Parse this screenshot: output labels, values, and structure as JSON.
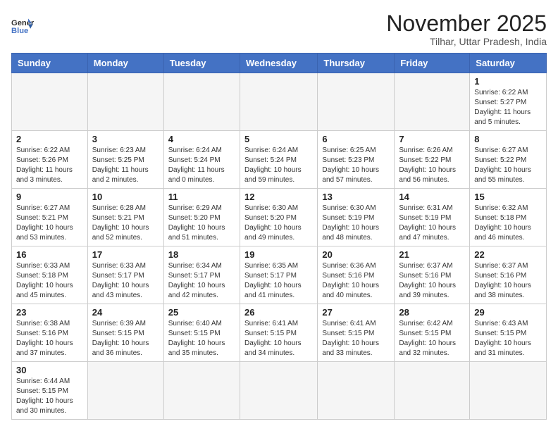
{
  "logo": {
    "text_general": "General",
    "text_blue": "Blue"
  },
  "title": "November 2025",
  "subtitle": "Tilhar, Uttar Pradesh, India",
  "days_of_week": [
    "Sunday",
    "Monday",
    "Tuesday",
    "Wednesday",
    "Thursday",
    "Friday",
    "Saturday"
  ],
  "weeks": [
    [
      {
        "day": "",
        "info": ""
      },
      {
        "day": "",
        "info": ""
      },
      {
        "day": "",
        "info": ""
      },
      {
        "day": "",
        "info": ""
      },
      {
        "day": "",
        "info": ""
      },
      {
        "day": "",
        "info": ""
      },
      {
        "day": "1",
        "info": "Sunrise: 6:22 AM\nSunset: 5:27 PM\nDaylight: 11 hours and 5 minutes."
      }
    ],
    [
      {
        "day": "2",
        "info": "Sunrise: 6:22 AM\nSunset: 5:26 PM\nDaylight: 11 hours and 3 minutes."
      },
      {
        "day": "3",
        "info": "Sunrise: 6:23 AM\nSunset: 5:25 PM\nDaylight: 11 hours and 2 minutes."
      },
      {
        "day": "4",
        "info": "Sunrise: 6:24 AM\nSunset: 5:24 PM\nDaylight: 11 hours and 0 minutes."
      },
      {
        "day": "5",
        "info": "Sunrise: 6:24 AM\nSunset: 5:24 PM\nDaylight: 10 hours and 59 minutes."
      },
      {
        "day": "6",
        "info": "Sunrise: 6:25 AM\nSunset: 5:23 PM\nDaylight: 10 hours and 57 minutes."
      },
      {
        "day": "7",
        "info": "Sunrise: 6:26 AM\nSunset: 5:22 PM\nDaylight: 10 hours and 56 minutes."
      },
      {
        "day": "8",
        "info": "Sunrise: 6:27 AM\nSunset: 5:22 PM\nDaylight: 10 hours and 55 minutes."
      }
    ],
    [
      {
        "day": "9",
        "info": "Sunrise: 6:27 AM\nSunset: 5:21 PM\nDaylight: 10 hours and 53 minutes."
      },
      {
        "day": "10",
        "info": "Sunrise: 6:28 AM\nSunset: 5:21 PM\nDaylight: 10 hours and 52 minutes."
      },
      {
        "day": "11",
        "info": "Sunrise: 6:29 AM\nSunset: 5:20 PM\nDaylight: 10 hours and 51 minutes."
      },
      {
        "day": "12",
        "info": "Sunrise: 6:30 AM\nSunset: 5:20 PM\nDaylight: 10 hours and 49 minutes."
      },
      {
        "day": "13",
        "info": "Sunrise: 6:30 AM\nSunset: 5:19 PM\nDaylight: 10 hours and 48 minutes."
      },
      {
        "day": "14",
        "info": "Sunrise: 6:31 AM\nSunset: 5:19 PM\nDaylight: 10 hours and 47 minutes."
      },
      {
        "day": "15",
        "info": "Sunrise: 6:32 AM\nSunset: 5:18 PM\nDaylight: 10 hours and 46 minutes."
      }
    ],
    [
      {
        "day": "16",
        "info": "Sunrise: 6:33 AM\nSunset: 5:18 PM\nDaylight: 10 hours and 45 minutes."
      },
      {
        "day": "17",
        "info": "Sunrise: 6:33 AM\nSunset: 5:17 PM\nDaylight: 10 hours and 43 minutes."
      },
      {
        "day": "18",
        "info": "Sunrise: 6:34 AM\nSunset: 5:17 PM\nDaylight: 10 hours and 42 minutes."
      },
      {
        "day": "19",
        "info": "Sunrise: 6:35 AM\nSunset: 5:17 PM\nDaylight: 10 hours and 41 minutes."
      },
      {
        "day": "20",
        "info": "Sunrise: 6:36 AM\nSunset: 5:16 PM\nDaylight: 10 hours and 40 minutes."
      },
      {
        "day": "21",
        "info": "Sunrise: 6:37 AM\nSunset: 5:16 PM\nDaylight: 10 hours and 39 minutes."
      },
      {
        "day": "22",
        "info": "Sunrise: 6:37 AM\nSunset: 5:16 PM\nDaylight: 10 hours and 38 minutes."
      }
    ],
    [
      {
        "day": "23",
        "info": "Sunrise: 6:38 AM\nSunset: 5:16 PM\nDaylight: 10 hours and 37 minutes."
      },
      {
        "day": "24",
        "info": "Sunrise: 6:39 AM\nSunset: 5:15 PM\nDaylight: 10 hours and 36 minutes."
      },
      {
        "day": "25",
        "info": "Sunrise: 6:40 AM\nSunset: 5:15 PM\nDaylight: 10 hours and 35 minutes."
      },
      {
        "day": "26",
        "info": "Sunrise: 6:41 AM\nSunset: 5:15 PM\nDaylight: 10 hours and 34 minutes."
      },
      {
        "day": "27",
        "info": "Sunrise: 6:41 AM\nSunset: 5:15 PM\nDaylight: 10 hours and 33 minutes."
      },
      {
        "day": "28",
        "info": "Sunrise: 6:42 AM\nSunset: 5:15 PM\nDaylight: 10 hours and 32 minutes."
      },
      {
        "day": "29",
        "info": "Sunrise: 6:43 AM\nSunset: 5:15 PM\nDaylight: 10 hours and 31 minutes."
      }
    ],
    [
      {
        "day": "30",
        "info": "Sunrise: 6:44 AM\nSunset: 5:15 PM\nDaylight: 10 hours and 30 minutes."
      },
      {
        "day": "",
        "info": ""
      },
      {
        "day": "",
        "info": ""
      },
      {
        "day": "",
        "info": ""
      },
      {
        "day": "",
        "info": ""
      },
      {
        "day": "",
        "info": ""
      },
      {
        "day": "",
        "info": ""
      }
    ]
  ]
}
